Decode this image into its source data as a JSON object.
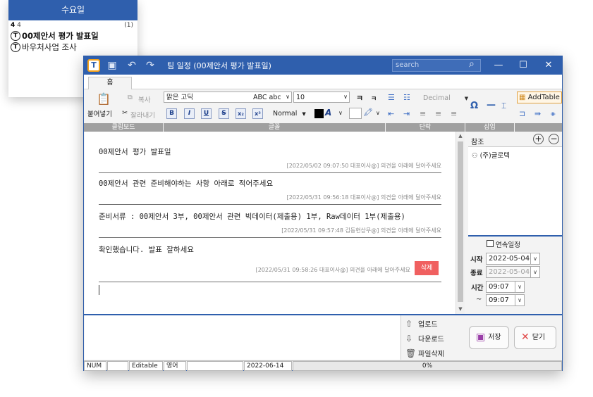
{
  "calendar": {
    "header": "수요일",
    "day_bold": "4",
    "day_light": "4",
    "count": "(1)",
    "events": [
      {
        "icon": "T",
        "label": "00제안서 평가 발표일",
        "bold": true
      },
      {
        "icon": "T",
        "label": "바우처사업 조사",
        "bold": false
      }
    ]
  },
  "window": {
    "title": "팀 일정 (00제안서 평가 발표일)",
    "search_placeholder": "search",
    "controls": {
      "minimize": "—",
      "maximize": "☐",
      "close": "✕"
    }
  },
  "ribbon": {
    "tab_home": "홈",
    "paste": "붙여넣기",
    "copy": "복사",
    "cut": "잘라내기",
    "font_name": "맑은 고딕",
    "font_preview": "ABC abc",
    "font_size": "10",
    "style": "Normal",
    "list_style": "Decimal",
    "add_table": "AddTable",
    "groups": {
      "clipboard": "클립보드",
      "font": "글꼴",
      "paragraph": "단락",
      "insert": "삽입"
    }
  },
  "messages": [
    {
      "text": "00제안서 평가 발표일",
      "meta": "[2022/05/02 09:07:50 대표이사@] 의견을 아래에 달아주세요"
    },
    {
      "text": "00제안서 관련 준비해야하는 사항 아래로 적어주세요",
      "meta": "[2022/05/31 09:56:18 대표이사@] 의견을 아래에 달아주세요"
    },
    {
      "text": "준비서류 : 00제안서 3부, 00제안서 관련 빅데이터(제출용) 1부, Raw데이터 1부(제출용)",
      "meta": "[2022/05/31 09:57:48 김동현상무@] 의견을 아래에 달아주세요"
    },
    {
      "text": "확인했습니다. 발표 잘하세요",
      "meta": "[2022/05/31 09:58:26 대표이사@] 의견을 아래에 달아주세요",
      "delete": "삭제"
    }
  ],
  "side": {
    "reference_title": "참조",
    "references": [
      "(주)글로텍"
    ],
    "continuous_label": "연속일정",
    "start_label": "시작",
    "start_date": "2022-05-04",
    "end_label": "종료",
    "end_date": "2022-05-04",
    "time_label": "시간",
    "time_start": "09:07",
    "tilde": "~",
    "time_end": "09:07"
  },
  "files": {
    "upload": "업로드",
    "download": "다운로드",
    "delete": "파일삭제"
  },
  "buttons": {
    "save": "저장",
    "close": "닫기"
  },
  "statusbar": {
    "num": "NUM",
    "editable": "Editable",
    "lang": "영어",
    "date": "2022-06-14",
    "progress": "0%"
  }
}
